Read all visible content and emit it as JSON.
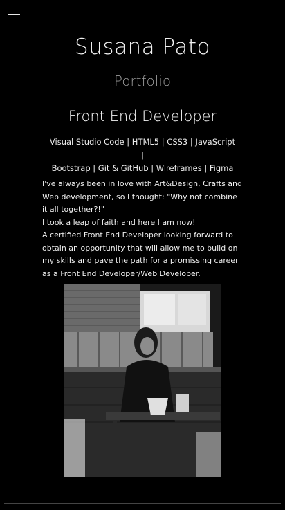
{
  "header": {
    "menu_icon": "hamburger-menu-icon",
    "name": "Susana Pato",
    "subtitle": "Portfolio"
  },
  "profile": {
    "role": "Front End Developer",
    "skills_line1": "Visual Studio Code | HTML5 | CSS3 | JavaScript |",
    "skills_line2": "Bootstrap | Git & GitHub | Wireframes | Figma",
    "bio": [
      "I've always been in love with Art&Design, Crafts and Web development, so I thought: \"Why not combine it all together?!\"",
      "I took a leap of faith and here I am now!",
      "A certified Front End Developer looking forward to obtain an opportunity that will allow me to build on my skills and pave the path for a promissing career as a Front End Developer/Web Developer."
    ]
  },
  "colors": {
    "background": "#000000",
    "text": "#ffffff",
    "subtitle": "#9a9a9a"
  }
}
